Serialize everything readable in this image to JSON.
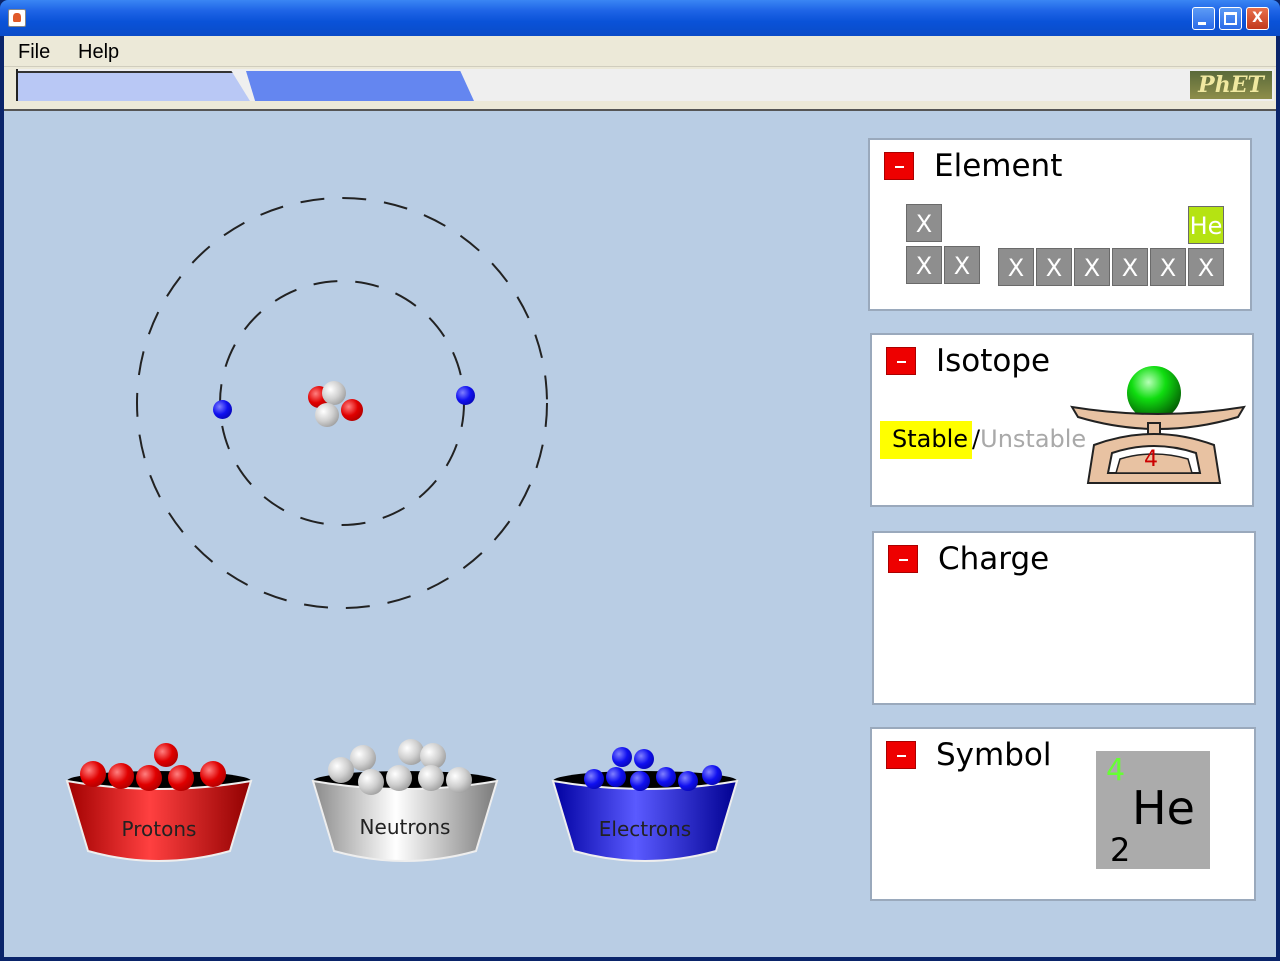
{
  "window": {
    "title": "",
    "buttons": {
      "minimize_icon": "minimize-icon",
      "maximize_icon": "maximize-icon",
      "close_icon": "close-icon",
      "close_glyph": "X"
    }
  },
  "menu": {
    "items": [
      {
        "label": "File"
      },
      {
        "label": "Help"
      }
    ]
  },
  "tabs": {
    "logo_text": "PhET"
  },
  "buckets": [
    {
      "label": "Protons",
      "color": "#dd0000"
    },
    {
      "label": "Neutrons",
      "color": "#bfbfbf"
    },
    {
      "label": "Electrons",
      "color": "#0000ee"
    }
  ],
  "panels": {
    "element": {
      "title": "Element",
      "cells": [
        {
          "label": "X"
        },
        {
          "label": "He"
        },
        {
          "label": "X"
        },
        {
          "label": "X"
        },
        {
          "label": "X"
        },
        {
          "label": "X"
        },
        {
          "label": "X"
        },
        {
          "label": "X"
        },
        {
          "label": "X"
        },
        {
          "label": "X"
        }
      ]
    },
    "isotope": {
      "title": "Isotope",
      "stable": "Stable",
      "slash": "/",
      "unstable": "Unstable",
      "scale_value": "4"
    },
    "charge": {
      "title": "Charge"
    },
    "symbol": {
      "title": "Symbol",
      "mass_number": "4",
      "element": "He",
      "atomic_number": "2"
    }
  },
  "colors": {
    "canvas_bg": "#b9cde4",
    "accent_red": "#ee0000",
    "highlight_yellow": "#ffff00",
    "active_element": "#b5e312"
  }
}
